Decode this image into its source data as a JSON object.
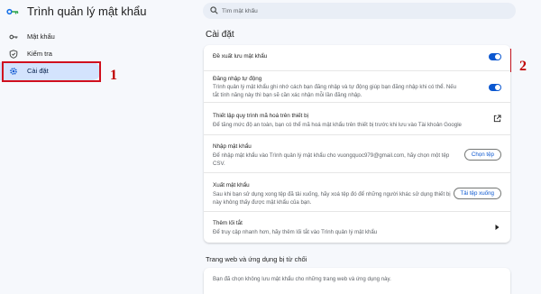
{
  "app": {
    "title": "Trình quản lý mật khẩu"
  },
  "search": {
    "placeholder": "Tìm mật khẩu"
  },
  "sidebar": {
    "items": [
      {
        "label": "Mật khẩu",
        "icon": "key-icon"
      },
      {
        "label": "Kiểm tra",
        "icon": "shield-check-icon"
      },
      {
        "label": "Cài đặt",
        "icon": "gear-icon"
      }
    ]
  },
  "settings": {
    "title": "Cài đặt",
    "offer_save": {
      "title": "Đề xuất lưu mật khẩu",
      "enabled": true
    },
    "auto_signin": {
      "title": "Đăng nhập tự động",
      "desc": "Trình quản lý mật khẩu ghi nhớ cách bạn đăng nhập và tự động giúp bạn đăng nhập khi có thể. Nếu tắt tính năng này thì bạn sẽ cần xác nhận mỗi lần đăng nhập.",
      "enabled": true
    },
    "encryption": {
      "title": "Thiết lập quy trình mã hoá trên thiết bị",
      "desc": "Để tăng mức độ an toàn, bạn có thể mã hoá mật khẩu trên thiết bị trước khi lưu vào Tài khoản Google"
    },
    "import": {
      "title": "Nhập mật khẩu",
      "desc": "Để nhập mật khẩu vào Trình quản lý mật khẩu cho vuongquoc979@gmail.com, hãy chọn một tệp CSV.",
      "button": "Chọn tệp"
    },
    "export": {
      "title": "Xuất mật khẩu",
      "desc": "Sau khi bạn sử dụng xong tệp đã tải xuống, hãy xoá tệp đó để những người khác sử dụng thiết bị này không thấy được mật khẩu của bạn.",
      "button": "Tải tệp xuống"
    },
    "shortcut": {
      "title": "Thêm lối tắt",
      "desc": "Để truy cập nhanh hơn, hãy thêm lối tắt vào Trình quản lý mật khẩu"
    }
  },
  "blocked": {
    "title": "Trang web và ứng dụng bị từ chối",
    "desc": "Bạn đã chọn không lưu mật khẩu cho những trang web và ứng dụng này."
  },
  "annotations": {
    "label1": "1",
    "label2": "2",
    "color": "#c00000"
  },
  "colors": {
    "accent": "#0b57d0",
    "active_nav": "#d3e3fd",
    "background": "#f6f8fc"
  }
}
